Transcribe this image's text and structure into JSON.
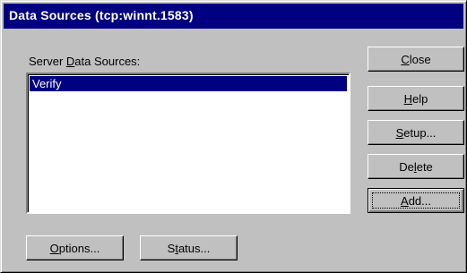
{
  "window": {
    "title": "Data Sources (tcp:winnt.1583)"
  },
  "list": {
    "label_pre": "Server ",
    "label_accel": "D",
    "label_post": "ata Sources:",
    "items": [
      "Verify"
    ],
    "selected_index": 0
  },
  "buttons": {
    "close": {
      "pre": "",
      "accel": "C",
      "post": "lose"
    },
    "help": {
      "pre": "",
      "accel": "H",
      "post": "elp"
    },
    "setup": {
      "pre": "",
      "accel": "S",
      "post": "etup..."
    },
    "delete": {
      "pre": "De",
      "accel": "l",
      "post": "ete"
    },
    "add": {
      "pre": "",
      "accel": "A",
      "post": "dd..."
    },
    "options": {
      "pre": "",
      "accel": "O",
      "post": "ptions..."
    },
    "status": {
      "pre": "S",
      "accel": "t",
      "post": "atus..."
    }
  },
  "colors": {
    "titlebar": "#000080",
    "selection": "#000080",
    "face": "#c0c0c0"
  }
}
